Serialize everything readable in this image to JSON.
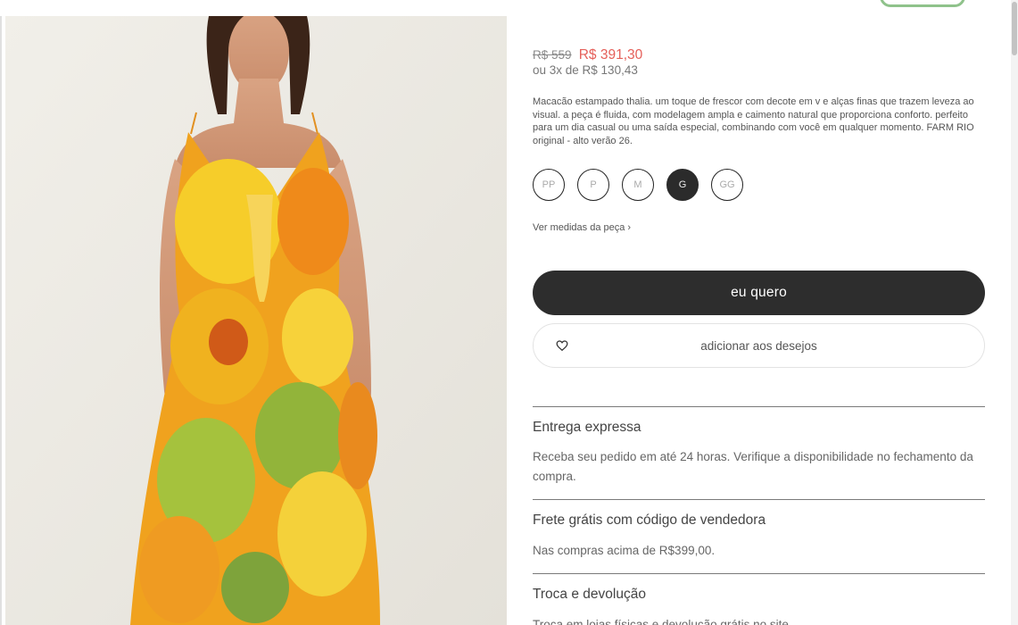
{
  "product": {
    "price_old": "R$ 559",
    "price_new": "R$ 391,30",
    "installments": "ou 3x de R$ 130,43",
    "description": "Macacão estampado thalia. um toque de frescor com decote em v e alças finas que trazem leveza ao visual. a peça é fluida, com modelagem ampla e caimento natural que proporciona conforto. perfeito para um dia casual ou uma saída especial, combinando com você em qualquer momento. FARM RIO original - alto verão 26.",
    "image_alt": "heart-icon"
  },
  "sizes": [
    {
      "label": "PP",
      "selected": false
    },
    {
      "label": "P",
      "selected": false
    },
    {
      "label": "M",
      "selected": false
    },
    {
      "label": "G",
      "selected": true
    },
    {
      "label": "GG",
      "selected": false
    }
  ],
  "measures_link": "Ver medidas da peça ›",
  "actions": {
    "buy_label": "eu quero",
    "wishlist_label": "adicionar aos desejos",
    "wishlist_icon": "heart-icon"
  },
  "sections": [
    {
      "title": "Entrega expressa",
      "text": "Receba seu pedido em até 24 horas. Verifique a disponibilidade no fechamento da compra."
    },
    {
      "title": "Frete grátis com código de vendedora",
      "text": "Nas compras acima de R$399,00."
    },
    {
      "title": "Troca e devolução",
      "text": "Troca em lojas físicas e devolução grátis no site."
    }
  ],
  "colors": {
    "accent_price": "#e5605a",
    "button_dark": "#2d2d2d",
    "green_outline": "#8fc28b"
  }
}
